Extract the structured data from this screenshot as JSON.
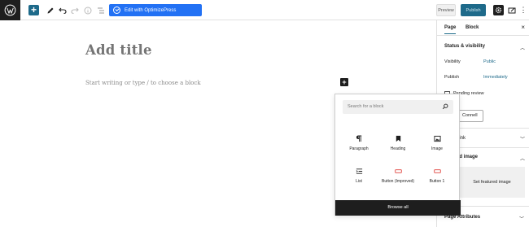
{
  "toolbar": {
    "add_label": "+",
    "optimize_label": "Edit with OptimizePress",
    "preview_label": "Preview",
    "publish_label": "Publish",
    "more_label": "⋮"
  },
  "editor": {
    "title_placeholder": "Add title",
    "block_placeholder": "Start writing or type / to choose a block",
    "inline_add_label": "+"
  },
  "inserter": {
    "search_placeholder": "Search for a block",
    "items": [
      {
        "label": "Paragraph",
        "icon": "paragraph-icon"
      },
      {
        "label": "Heading",
        "icon": "heading-icon"
      },
      {
        "label": "Image",
        "icon": "image-icon"
      },
      {
        "label": "List",
        "icon": "list-icon"
      },
      {
        "label": "Button (Improved)",
        "icon": "button-icon"
      },
      {
        "label": "Button 1",
        "icon": "button-icon"
      }
    ],
    "browse_all_label": "Browse all"
  },
  "sidebar": {
    "tabs": [
      {
        "label": "Page",
        "active": true
      },
      {
        "label": "Block",
        "active": false
      }
    ],
    "close_label": "×",
    "status_panel": {
      "title": "Status & visibility",
      "visibility_key": "Visibility",
      "visibility_value": "Public",
      "publish_key": "Publish",
      "publish_value": "Immediately",
      "pending_label": "Pending review",
      "author_value": "Connell"
    },
    "permalink_title": "Link",
    "featured_title": "ed image",
    "featured_button": "Set featured image",
    "attributes_title": "Page Attributes"
  },
  "colors": {
    "accent": "#1e6a8a",
    "optimize_blue": "#2271f4",
    "dark": "#1e1e1e"
  }
}
